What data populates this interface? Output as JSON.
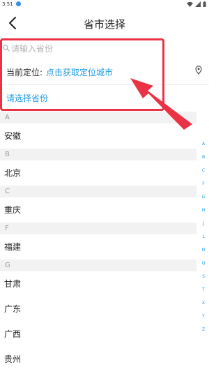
{
  "status_bar": {
    "time": "3:51"
  },
  "nav": {
    "title": "省市选择"
  },
  "search": {
    "placeholder": "请输入省份",
    "value": ""
  },
  "location": {
    "label": "当前定位:",
    "action": "点击获取定位城市"
  },
  "province_prompt": "请选择省份",
  "sections": [
    {
      "letter": "A",
      "items": [
        "安徽"
      ]
    },
    {
      "letter": "B",
      "items": [
        "北京"
      ]
    },
    {
      "letter": "C",
      "items": [
        "重庆"
      ]
    },
    {
      "letter": "F",
      "items": [
        "福建"
      ]
    },
    {
      "letter": "G",
      "items": [
        "甘肃",
        "广东",
        "广西",
        "贵州"
      ]
    }
  ],
  "index_letters": [
    "A",
    "B",
    "C",
    "F",
    "G",
    "H",
    "J",
    "L",
    "N",
    "Q",
    "S",
    "T",
    "X",
    "Y",
    "Z"
  ],
  "colors": {
    "accent": "#1f9be8",
    "annotation": "#ea3344"
  },
  "annotation": {
    "highlight_box": true,
    "arrow": true
  }
}
